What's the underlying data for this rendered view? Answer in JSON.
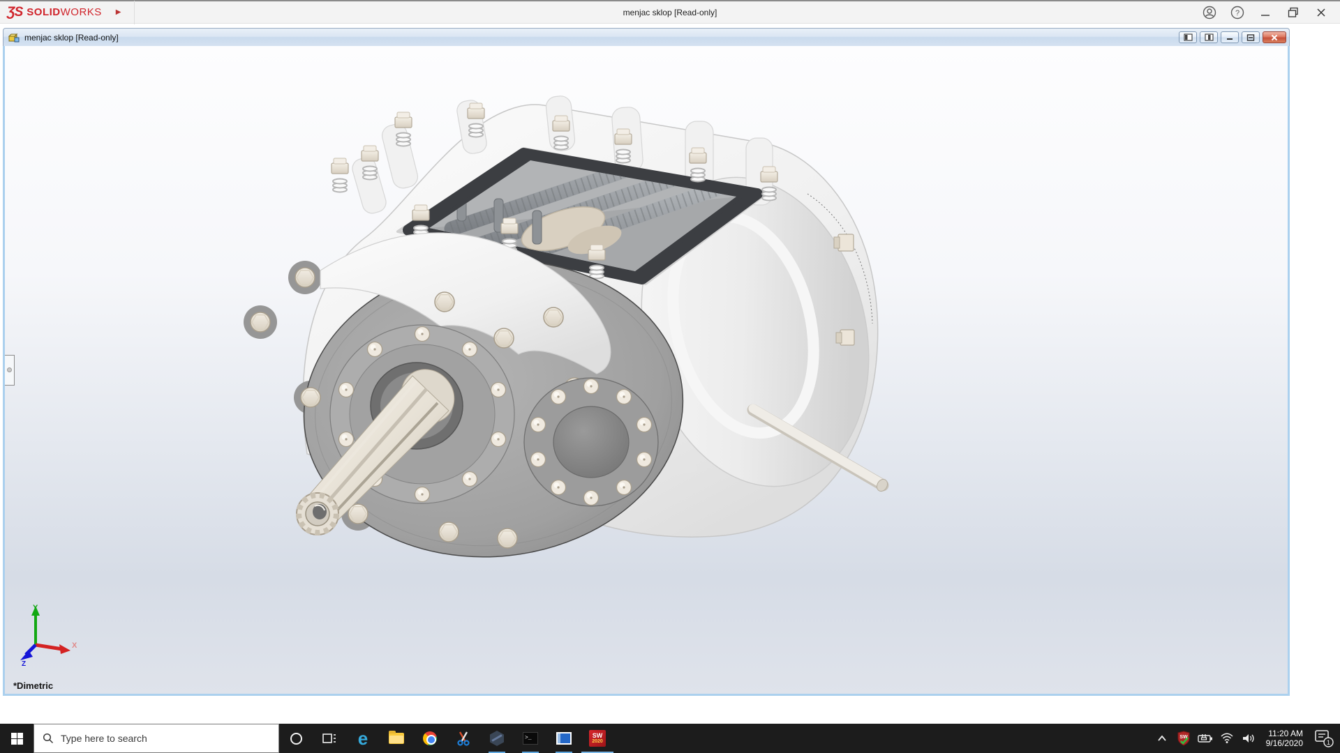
{
  "app": {
    "brand": {
      "mark": "ƷS",
      "solid": "SOLID",
      "works": "WORKS",
      "arrow_glyph": "▶",
      "color": "#d0242b"
    },
    "title": "menjac sklop [Read-only]",
    "controls": {
      "help_glyph": "?"
    },
    "titlebar_icons": [
      "account-icon",
      "help-icon",
      "minimize-icon",
      "restore-icon",
      "close-icon"
    ]
  },
  "document": {
    "title": "menjac sklop [Read-only]",
    "window_buttons": [
      "pane-left",
      "pane-right",
      "minimize",
      "maximize",
      "close"
    ],
    "view_label": "*Dimetric",
    "triad": {
      "x": "X",
      "y": "Y",
      "z": "Z",
      "x_color": "#e02020",
      "y_color": "#12a812",
      "z_color": "#1414d8"
    }
  },
  "taskbar": {
    "start": "start-button",
    "search_placeholder": "Type here to search",
    "icons": [
      {
        "name": "cortana",
        "open": false
      },
      {
        "name": "task-view",
        "open": false
      },
      {
        "name": "edge",
        "open": false
      },
      {
        "name": "file-explorer",
        "open": false
      },
      {
        "name": "chrome",
        "open": false
      },
      {
        "name": "snipping-tool",
        "open": false
      },
      {
        "name": "hexagon-app",
        "open": true
      },
      {
        "name": "command-prompt",
        "open": true
      },
      {
        "name": "media-app",
        "open": true
      },
      {
        "name": "solidworks-2020",
        "open": true,
        "active": true
      }
    ],
    "glyphs": {
      "edge": "e",
      "cmd": ">_",
      "sw": "SW",
      "sw_year": "2020"
    },
    "tray": {
      "icons": [
        "chevron-up",
        "solidworks-resource-monitor",
        "power",
        "wifi",
        "volume"
      ],
      "time": "11:20 AM",
      "date": "9/16/2020",
      "badge": "1"
    }
  }
}
